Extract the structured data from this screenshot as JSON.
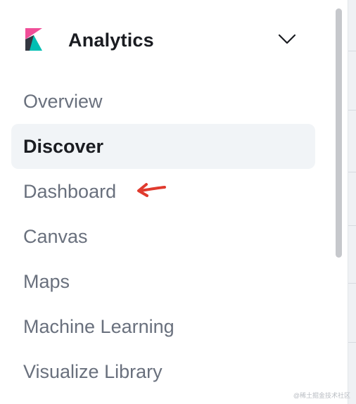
{
  "group": {
    "title": "Analytics",
    "logo_icon": "kibana-logo-icon",
    "toggle_icon": "chevron-down-icon"
  },
  "nav": {
    "items": [
      {
        "label": "Overview",
        "active": false
      },
      {
        "label": "Discover",
        "active": true
      },
      {
        "label": "Dashboard",
        "active": false
      },
      {
        "label": "Canvas",
        "active": false
      },
      {
        "label": "Maps",
        "active": false
      },
      {
        "label": "Machine Learning",
        "active": false
      },
      {
        "label": "Visualize Library",
        "active": false
      }
    ]
  },
  "annotation": {
    "icon": "red-arrow-icon",
    "color": "#e03a2e"
  },
  "watermark": {
    "text": "@稀土掘金技术社区"
  },
  "colors": {
    "active_bg": "#f1f4f7",
    "text_primary": "#1a1c21",
    "text_secondary": "#69707d",
    "logo_pink": "#f04e98",
    "logo_teal": "#00bfb3",
    "logo_dark": "#343741"
  }
}
